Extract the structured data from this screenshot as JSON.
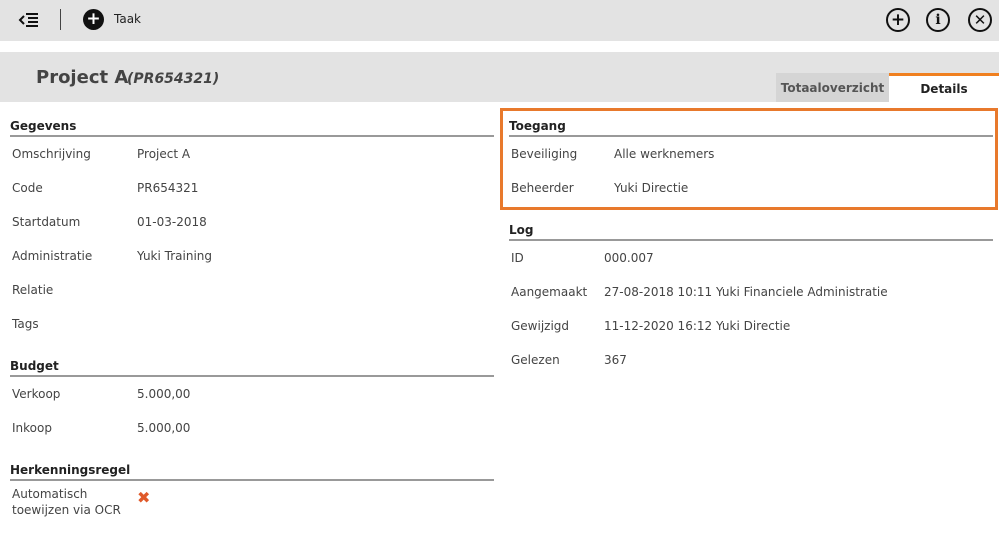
{
  "toolbar": {
    "back_icon": "collapse-menu-icon",
    "add_label": "Taak",
    "right_icons": [
      "plus-circle-icon",
      "info-circle-icon",
      "close-circle-icon"
    ]
  },
  "header": {
    "title": "Project A",
    "code": "(PR654321)",
    "tabs": [
      {
        "label": "Totaaloverzicht",
        "active": false
      },
      {
        "label": "Details",
        "active": true
      }
    ]
  },
  "gegevens": {
    "title": "Gegevens",
    "rows": [
      {
        "label": "Omschrijving",
        "value": "Project A"
      },
      {
        "label": "Code",
        "value": "PR654321"
      },
      {
        "label": "Startdatum",
        "value": "01-03-2018"
      },
      {
        "label": "Administratie",
        "value": "Yuki Training"
      },
      {
        "label": "Relatie",
        "value": ""
      },
      {
        "label": "Tags",
        "value": ""
      }
    ]
  },
  "budget": {
    "title": "Budget",
    "rows": [
      {
        "label": "Verkoop",
        "value": "5.000,00"
      },
      {
        "label": "Inkoop",
        "value": "5.000,00"
      }
    ]
  },
  "herkenningsregel": {
    "title": "Herkenningsregel",
    "label_line1": "Automatisch",
    "label_line2": "toewijzen via OCR",
    "value_icon": "cross-icon",
    "value_color": "#e05a2a"
  },
  "toegang": {
    "title": "Toegang",
    "rows": [
      {
        "label": "Beveiliging",
        "value": "Alle werknemers"
      },
      {
        "label": "Beheerder",
        "value": "Yuki Directie"
      }
    ],
    "highlight_color": "#e8792c"
  },
  "log": {
    "title": "Log",
    "rows": [
      {
        "label": "ID",
        "value": "000.007"
      },
      {
        "label": "Aangemaakt",
        "value": "27-08-2018 10:11 Yuki Financiele Administratie"
      },
      {
        "label": "Gewijzigd",
        "value": "11-12-2020 16:12 Yuki Directie"
      },
      {
        "label": "Gelezen",
        "value": "367"
      }
    ]
  }
}
